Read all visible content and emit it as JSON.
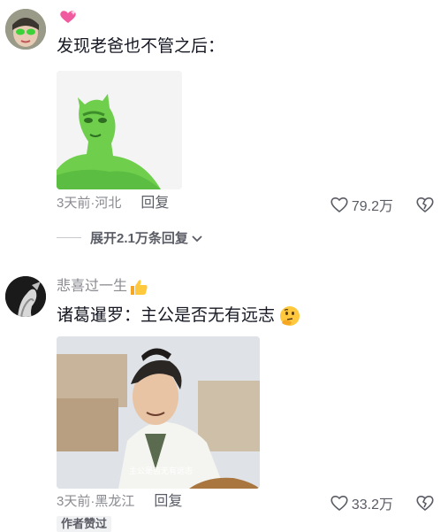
{
  "comments": [
    {
      "username": "",
      "text": "发现老爸也不管之后：",
      "time": "3天前",
      "location": "河北",
      "reply_label": "回复",
      "likes": "79.2万",
      "expand_label": "展开2.1万条回复"
    },
    {
      "username": "悲喜过一生",
      "text": "诸葛暹罗：主公是否无有远志",
      "time": "3天前",
      "location": "黑龙江",
      "reply_label": "回复",
      "likes": "33.2万",
      "author_badge": "作者赞过",
      "image_caption": "主公是否无有远志"
    }
  ],
  "separator": " · ",
  "icons": {
    "heart": "heart-outline-icon",
    "dislike": "broken-heart-icon",
    "chevron": "chevron-down-icon"
  },
  "colors": {
    "meta_gray": "#8a8b91",
    "text_dark": "#161823",
    "badge_bg": "#f1f2f4"
  }
}
